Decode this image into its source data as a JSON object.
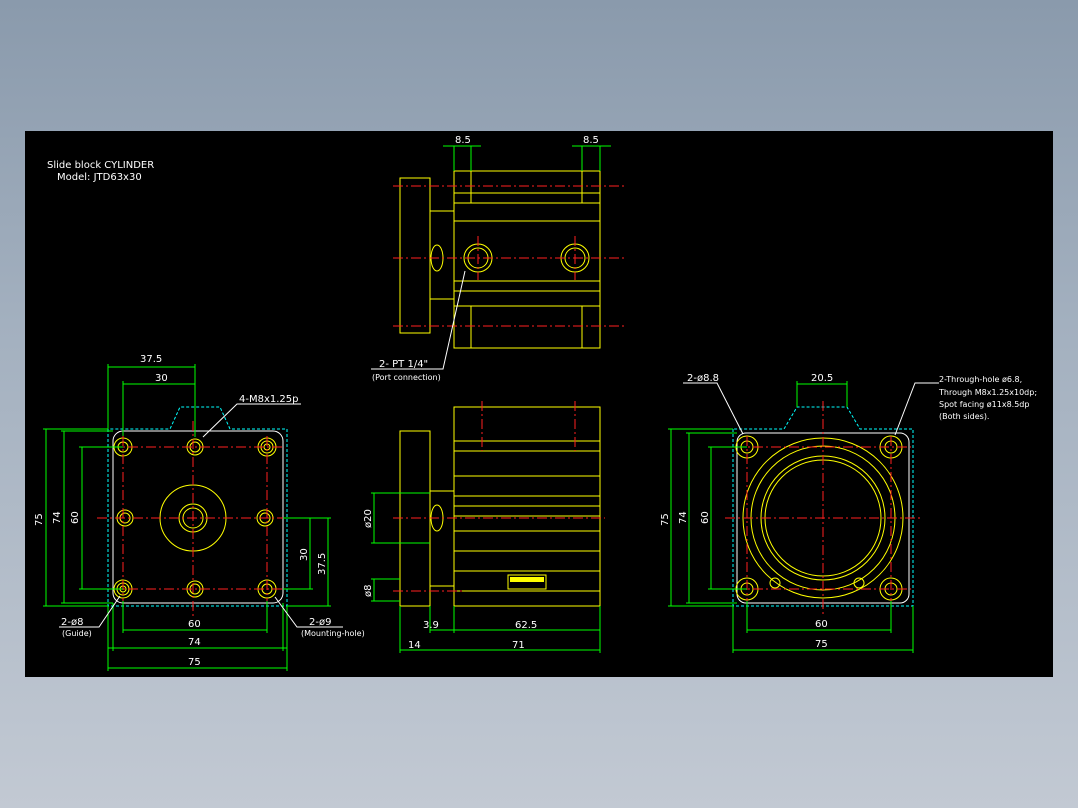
{
  "title": {
    "line1": "Slide block CYLINDER",
    "line2": "Model: JTD63x30"
  },
  "top_view": {
    "dim_left": "8.5",
    "dim_right": "8.5",
    "port_label": "2- PT 1/4\"",
    "port_note": "(Port connection)"
  },
  "left_view": {
    "dim_37_5_top": "37.5",
    "dim_30_top": "30",
    "tap_label": "4-M8x1.25p",
    "dim_75_v": "75",
    "dim_74_v": "74",
    "dim_60_v": "60",
    "dim_30_v": "30",
    "dim_37_5_v": "37.5",
    "dim_60_h": "60",
    "dim_74_h": "74",
    "dim_75_h": "75",
    "guide_label": "2-ø8",
    "guide_note": "(Guide)",
    "mount_label": "2-ø9",
    "mount_note": "(Mounting-hole)"
  },
  "center_view": {
    "dim_dia20": "ø20",
    "dim_dia8": "ø8",
    "dim_3_9": "3.9",
    "dim_62_5": "62.5",
    "dim_14": "14",
    "dim_71": "71"
  },
  "right_view": {
    "dim_20_5": "20.5",
    "hole_label": "2-ø8.8",
    "through_line1": "2-Through-hole ø6.8,",
    "through_line2": "Through M8x1.25x10dp;",
    "through_line3": "Spot facing ø11x8.5dp",
    "through_line4": "(Both sides).",
    "dim_75_v": "75",
    "dim_74_v": "74",
    "dim_60_v": "60",
    "dim_60_h": "60",
    "dim_75_h": "75"
  },
  "colors": {
    "background": "#000000",
    "outline": "#ffff00",
    "dimension": "#00ff00",
    "centerline": "#ff2020",
    "hidden": "#00ffff",
    "text": "#ffffff"
  }
}
